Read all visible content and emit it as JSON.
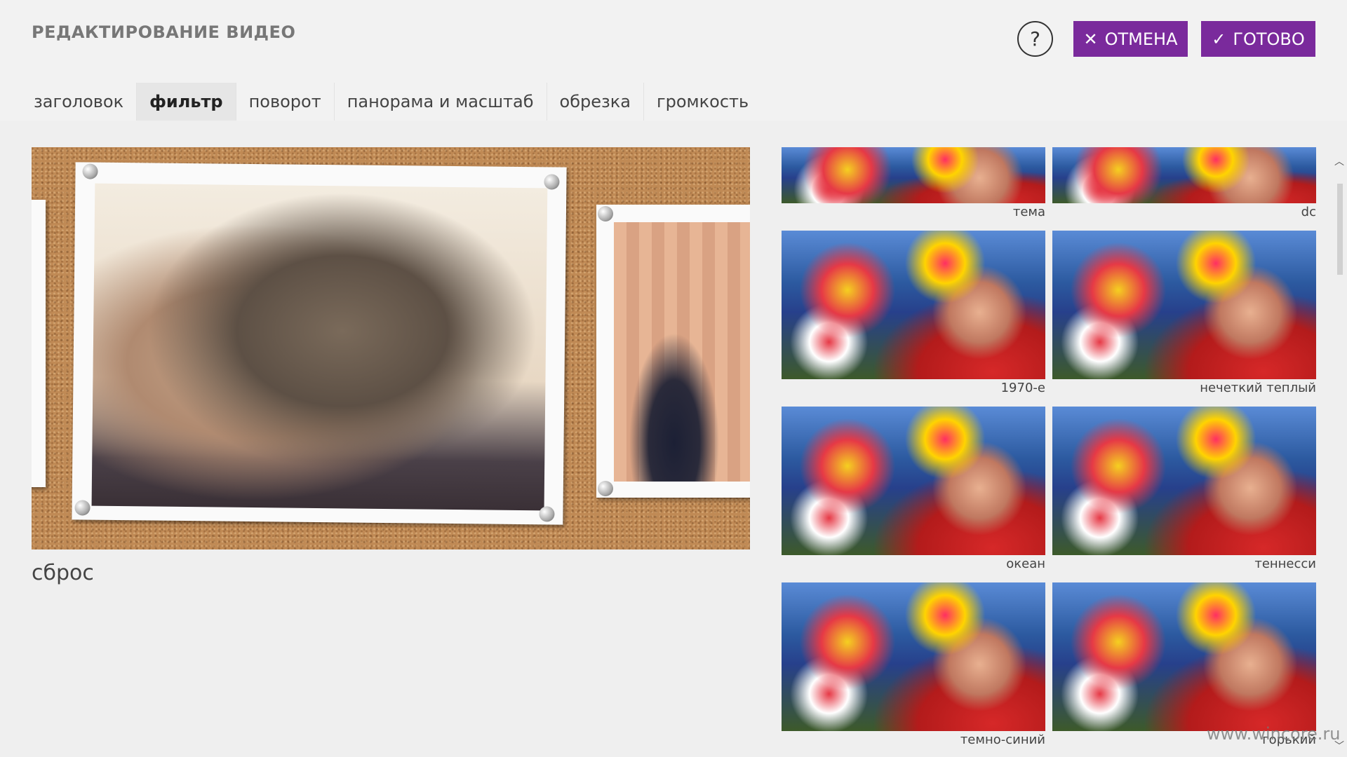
{
  "header": {
    "title": "РЕДАКТИРОВАНИЕ ВИДЕО",
    "help_label": "?",
    "cancel_label": "ОТМЕНА",
    "done_label": "ГОТОВО",
    "accent_color": "#7a2a9c"
  },
  "tabs": [
    {
      "label": "заголовок",
      "active": false
    },
    {
      "label": "фильтр",
      "active": true
    },
    {
      "label": "поворот",
      "active": false
    },
    {
      "label": "панорама и масштаб",
      "active": false
    },
    {
      "label": "обрезка",
      "active": false
    },
    {
      "label": "громкость",
      "active": false
    }
  ],
  "preview": {
    "reset_label": "сброс"
  },
  "filters": [
    {
      "label": "тема"
    },
    {
      "label": "dc"
    },
    {
      "label": "1970-е"
    },
    {
      "label": "нечеткий теплый"
    },
    {
      "label": "океан"
    },
    {
      "label": "теннесси"
    },
    {
      "label": "темно-синий"
    },
    {
      "label": "горький"
    }
  ],
  "watermark": "www.wincore.ru",
  "icons": {
    "cancel": "close-icon",
    "done": "checkmark-icon",
    "scroll_up": "chevron-up-icon",
    "scroll_down": "chevron-down-icon"
  }
}
